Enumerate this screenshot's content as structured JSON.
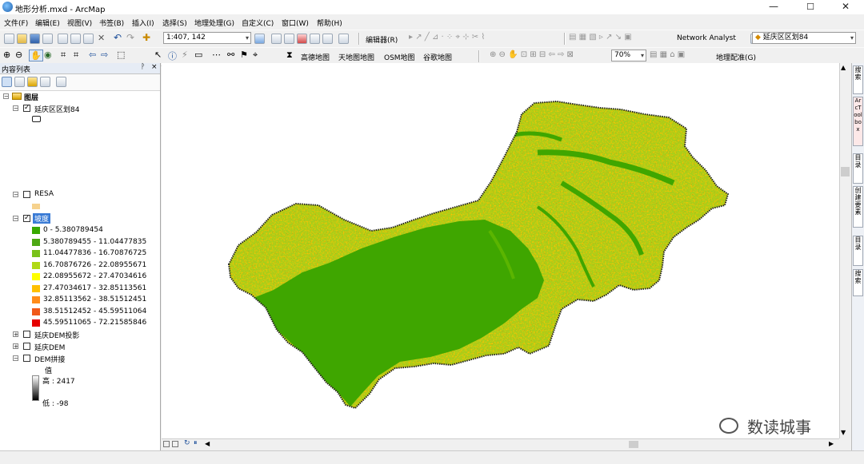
{
  "window": {
    "title": "地形分析.mxd - ArcMap",
    "minimize": "—",
    "maximize": "☐",
    "close": "✕"
  },
  "menu": [
    "文件(F)",
    "编辑(E)",
    "视图(V)",
    "书签(B)",
    "插入(I)",
    "选择(S)",
    "地理处理(G)",
    "自定义(C)",
    "窗口(W)",
    "帮助(H)"
  ],
  "toolbar1": {
    "scale": "1:407, 142",
    "editor_label": "编辑器(R)",
    "network_analyst": "Network Analyst",
    "layer_combo": "延庆区区划84"
  },
  "toolbar2": {
    "basemaps": [
      "高德地图",
      "天地图地图",
      "OSM地图",
      "谷歌地图"
    ],
    "zoom": "70%",
    "georef": "地理配准(G)"
  },
  "toc": {
    "title": "内容列表",
    "pin": "ᚹ",
    "close": "×",
    "root": "图层",
    "layers": [
      {
        "name": "延庆区区划84",
        "checked": true,
        "expanded": true
      },
      {
        "name": "RESA",
        "checked": false,
        "expanded": true
      },
      {
        "name": "坡度",
        "checked": true,
        "expanded": true,
        "selected": true
      },
      {
        "name": "延庆DEM投影",
        "checked": false,
        "expanded": false
      },
      {
        "name": "延庆DEM",
        "checked": false,
        "expanded": false
      },
      {
        "name": "DEM拼接",
        "checked": false,
        "expanded": true
      }
    ],
    "slope_legend": [
      {
        "label": "0 - 5.380789454",
        "color": "#38a800"
      },
      {
        "label": "5.380789455 - 11.04477835",
        "color": "#4ea814"
      },
      {
        "label": "11.04477836 - 16.70876725",
        "color": "#79c21a"
      },
      {
        "label": "16.70876726 - 22.08955671",
        "color": "#b0d916"
      },
      {
        "label": "22.08955672 - 27.47034616",
        "color": "#ffff00"
      },
      {
        "label": "27.47034617 - 32.85113561",
        "color": "#ffc000"
      },
      {
        "label": "32.85113562 - 38.51512451",
        "color": "#ff8c1a"
      },
      {
        "label": "38.51512452 - 45.59511064",
        "color": "#f05a1a"
      },
      {
        "label": "45.59511065 - 72.21585846",
        "color": "#e60000"
      }
    ],
    "dem_legend": {
      "value_label": "值",
      "high": "高 : 2417",
      "low": "低 : -98"
    }
  },
  "right_dock": [
    "搜索",
    "ArcToolbox",
    "目录",
    "创建要素",
    "目录",
    "搜索"
  ],
  "watermark": "数读城事"
}
